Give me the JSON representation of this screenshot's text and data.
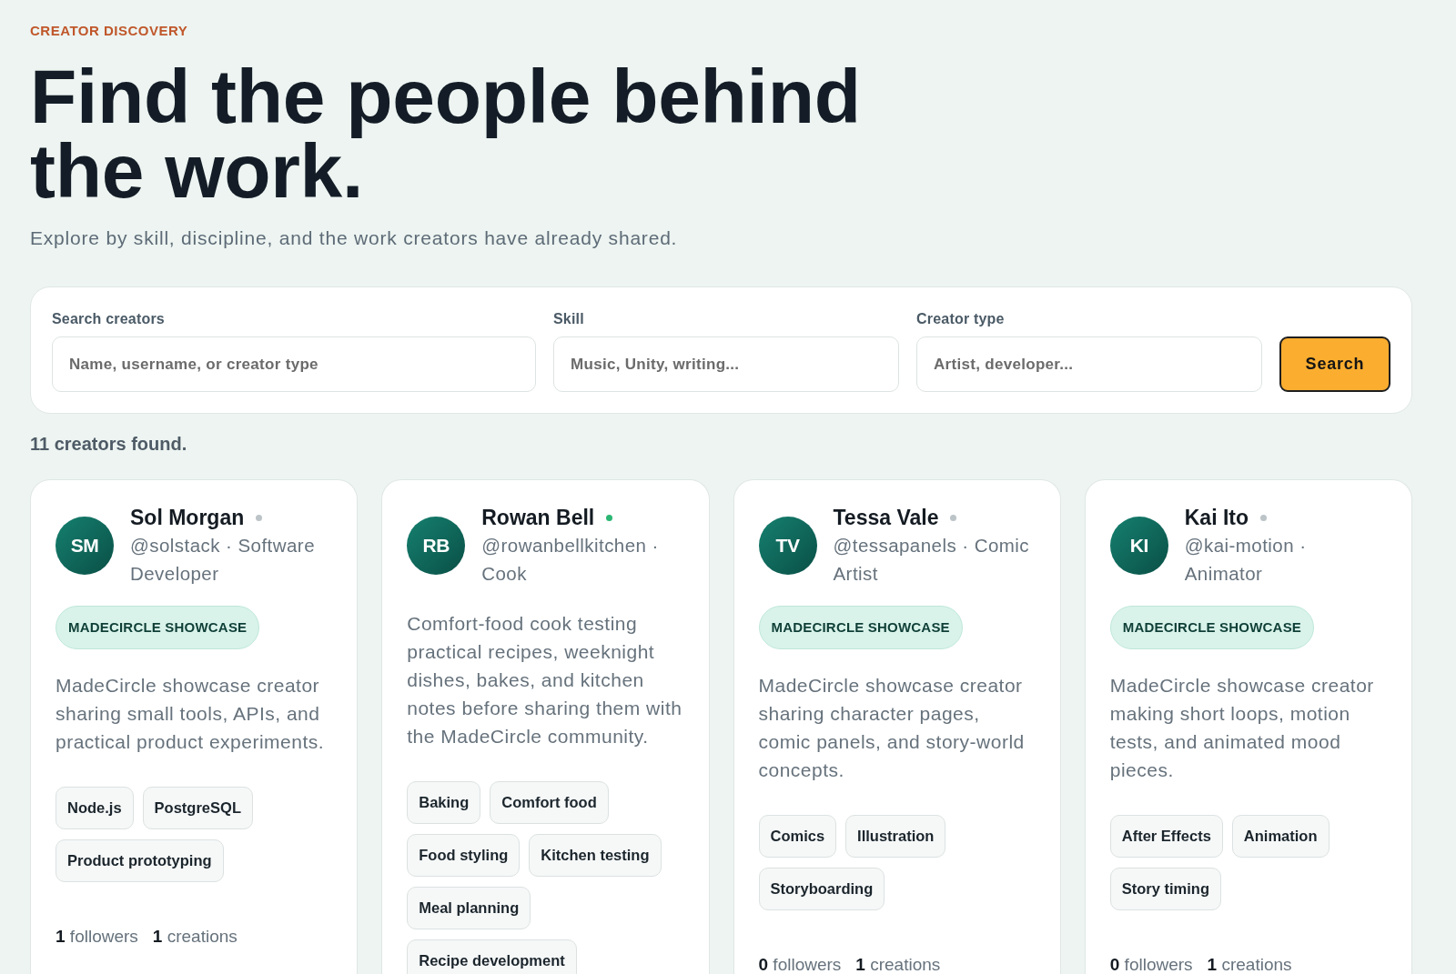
{
  "eyebrow": "CREATOR DISCOVERY",
  "heading": "Find the people behind the work.",
  "subtitle": "Explore by skill, discipline, and the work creators have already shared.",
  "search_form": {
    "fields": [
      {
        "label": "Search creators",
        "placeholder": "Name, username, or creator type"
      },
      {
        "label": "Skill",
        "placeholder": "Music, Unity, writing..."
      },
      {
        "label": "Creator type",
        "placeholder": "Artist, developer..."
      }
    ],
    "button": "Search"
  },
  "result_count": "11 creators found.",
  "cards": [
    {
      "initials": "SM",
      "name": "Sol Morgan",
      "online": false,
      "meta": "@solstack · Software Developer",
      "badge": "MADECIRCLE SHOWCASE",
      "description": "MadeCircle showcase creator sharing small tools, APIs, and practical product experiments.",
      "tags": [
        "Node.js",
        "PostgreSQL",
        "Product prototyping"
      ],
      "stats": [
        {
          "count": "1",
          "label": "followers"
        },
        {
          "count": "1",
          "label": "creations"
        }
      ]
    },
    {
      "initials": "RB",
      "name": "Rowan Bell",
      "online": true,
      "meta": "@rowanbellkitchen · Cook",
      "description": "Comfort-food cook testing practical recipes, weeknight dishes, bakes, and kitchen notes before sharing them with the MadeCircle community.",
      "tags": [
        "Baking",
        "Comfort food",
        "Food styling",
        "Kitchen testing",
        "Meal planning",
        "Recipe development"
      ]
    },
    {
      "initials": "TV",
      "name": "Tessa Vale",
      "online": false,
      "meta": "@tessapanels · Comic Artist",
      "badge": "MADECIRCLE SHOWCASE",
      "description": "MadeCircle showcase creator sharing character pages, comic panels, and story-world concepts.",
      "tags": [
        "Comics",
        "Illustration",
        "Storyboarding"
      ],
      "stats": [
        {
          "count": "0",
          "label": "followers"
        },
        {
          "count": "1",
          "label": "creations"
        }
      ]
    },
    {
      "initials": "KI",
      "name": "Kai Ito",
      "online": false,
      "meta": "@kai-motion · Animator",
      "badge": "MADECIRCLE SHOWCASE",
      "description": "MadeCircle showcase creator making short loops, motion tests, and animated mood pieces.",
      "tags": [
        "After Effects",
        "Animation",
        "Story timing"
      ],
      "stats": [
        {
          "count": "0",
          "label": "followers"
        },
        {
          "count": "1",
          "label": "creations"
        }
      ]
    }
  ]
}
